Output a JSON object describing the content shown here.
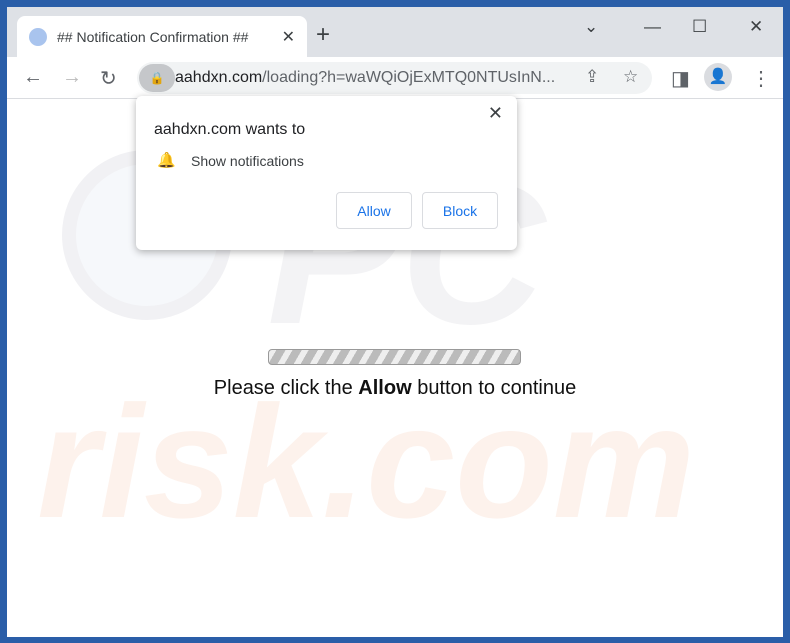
{
  "tab": {
    "title": "## Notification Confirmation ##",
    "close": "✕",
    "new_tab": "+"
  },
  "window_controls": {
    "dropdown": "⌄",
    "minimize": "—",
    "maximize": "☐",
    "close": "✕"
  },
  "nav": {
    "back": "←",
    "forward": "→",
    "reload": "↻"
  },
  "omnibox": {
    "domain": "aahdxn.com",
    "path": "/loading?h=waWQiOjExMTQ0NTUsInN..."
  },
  "toolbar_icons": {
    "share": "⇪",
    "star": "☆",
    "sidepanel": "◨",
    "menu": "⋮"
  },
  "popup": {
    "title": "aahdxn.com wants to",
    "permission": "Show notifications",
    "close": "✕",
    "allow": "Allow",
    "block": "Block"
  },
  "page": {
    "msg_pre": "Please click the ",
    "msg_bold": "Allow",
    "msg_post": " button to continue",
    "progress": "indeterminate"
  },
  "watermark": "PC risk.com",
  "colors": {
    "frame": "#2a5ea8",
    "accent": "#1a73e8"
  }
}
